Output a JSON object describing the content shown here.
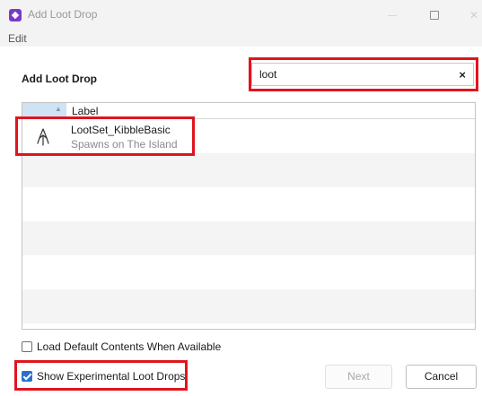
{
  "window": {
    "title": "Add Loot Drop",
    "app_icon": "diamond-app-icon",
    "controls": {
      "minimize": "minimize-icon",
      "maximize": "maximize-icon",
      "close": "close-icon"
    }
  },
  "menu": {
    "items": [
      {
        "label": "Edit"
      }
    ]
  },
  "header": {
    "title": "Add Loot Drop"
  },
  "search": {
    "value": "loot",
    "clear_label": "×"
  },
  "list": {
    "columns": [
      {
        "label": "Label",
        "sort": "ascending"
      }
    ],
    "items": [
      {
        "name": "LootSet_KibbleBasic",
        "subtitle": "Spawns on The Island",
        "icon": "loot-drop-icon"
      }
    ]
  },
  "options": {
    "load_default": {
      "label": "Load Default Contents When Available",
      "checked": false
    },
    "show_experimental": {
      "label": "Show Experimental Loot Drops",
      "checked": true
    }
  },
  "buttons": {
    "next": "Next",
    "cancel": "Cancel"
  },
  "colors": {
    "highlight": "#e0141e",
    "accent": "#2a6fcf",
    "app_icon": "#7a38c8"
  }
}
